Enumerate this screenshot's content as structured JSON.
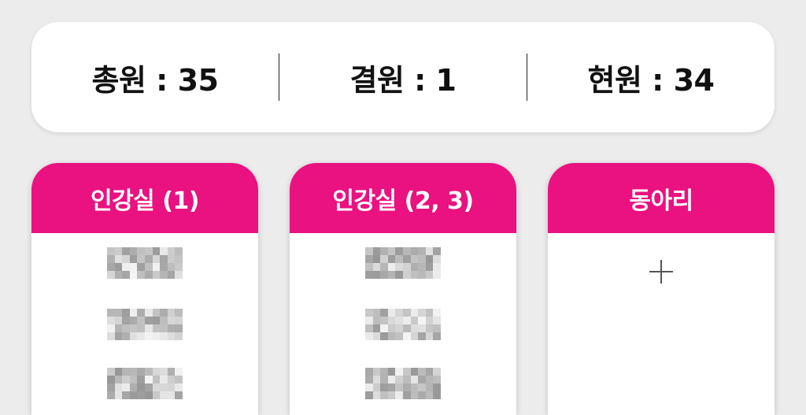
{
  "stats": {
    "total": "총원 : 35",
    "absent": "결원 : 1",
    "present": "현원 : 34"
  },
  "cards": [
    {
      "title": "인강실 (1)"
    },
    {
      "title": "인강실 (2, 3)"
    },
    {
      "title": "동아리",
      "add_icon": "plus-icon"
    }
  ],
  "colors": {
    "accent": "#ea1180",
    "background": "#ececec",
    "card": "#ffffff"
  }
}
